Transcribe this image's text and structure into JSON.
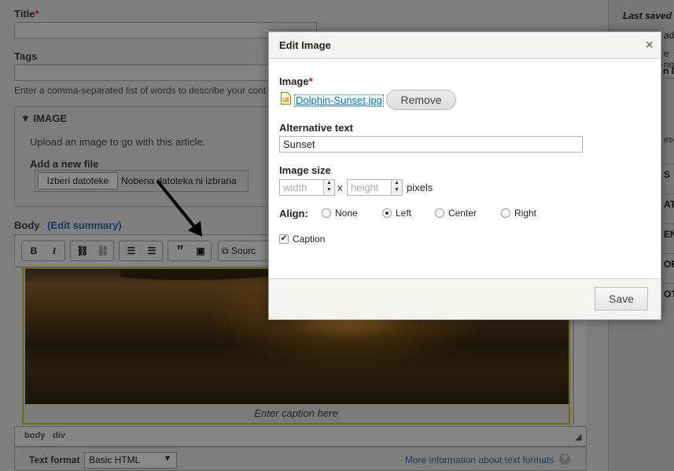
{
  "form": {
    "title_label": "Title",
    "required_mark": "*",
    "tags_label": "Tags",
    "tags_description": "Enter a comma-separated list of words to describe your cont",
    "image_section": {
      "legend": "IMAGE",
      "description": "Upload an image to go with this article.",
      "add_label": "Add a new file",
      "choose_button": "Izberi datoteke",
      "no_file_text": "Nobena datoteka ni izbrana"
    },
    "body_label": "Body",
    "edit_summary": "(Edit summary)",
    "toolbar": {
      "bold": "B",
      "italic": "I",
      "source": "Sourc"
    },
    "caption_placeholder": "Enter caption here",
    "path": [
      "body",
      "div"
    ],
    "text_format_label": "Text format",
    "text_format_value": "Basic HTML",
    "more_info_link": "More information about text formats"
  },
  "sidebar": {
    "last_saved": "Last saved",
    "fragments": [
      "ad",
      "e no",
      "n lo",
      "escr",
      "S",
      "AT",
      "EN",
      "OR",
      "OT"
    ]
  },
  "dialog": {
    "title": "Edit Image",
    "close": "×",
    "image_label": "Image",
    "required_mark": "*",
    "file_name": "Dolphin-Sunset.jpg",
    "remove_button": "Remove",
    "alt_label": "Alternative text",
    "alt_value": "Sunset",
    "size_label": "Image size",
    "width_placeholder": "width",
    "height_placeholder": "height",
    "size_separator": "x",
    "size_unit": "pixels",
    "align_label": "Align:",
    "align_options": [
      "None",
      "Left",
      "Center",
      "Right"
    ],
    "align_selected": "Left",
    "caption_label": "Caption",
    "caption_checked": true,
    "save_button": "Save"
  }
}
